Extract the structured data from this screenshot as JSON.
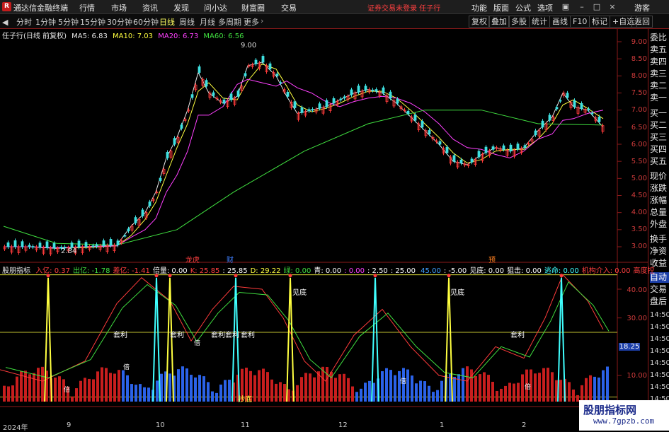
{
  "titlebar": {
    "logo": "R",
    "app_name": "通达信金融终端",
    "menus": [
      "行情",
      "市场",
      "资讯",
      "发现",
      "问小达",
      "财富圈",
      "交易"
    ],
    "notice": "证券交易未登录  任子行",
    "right_menus": [
      "功能",
      "版面",
      "公式",
      "选项"
    ],
    "guest": "游客"
  },
  "toolbar": {
    "periods": [
      "分时",
      "1分钟",
      "5分钟",
      "15分钟",
      "30分钟",
      "60分钟",
      "日线",
      "周线",
      "月线",
      "多周期",
      "更多"
    ],
    "active_period": "日线",
    "right_buttons": [
      "复权",
      "叠加",
      "多股",
      "统计",
      "画线",
      "F10",
      "标记",
      "+自选",
      "返回"
    ]
  },
  "stock": {
    "name": "任子行(日线 前复权)",
    "ma5": "MA5: 6.83",
    "ma10": "MA10: 7.03",
    "ma20": "MA20: 6.73",
    "ma60": "MA60: 6.56",
    "high_label": "9.00",
    "low_label": "2.84",
    "markers": [
      " 龙虎",
      "财",
      "预"
    ]
  },
  "price_axis": [
    "9.00",
    "8.50",
    "8.00",
    "7.50",
    "7.00",
    "6.50",
    "6.00",
    "5.50",
    "5.00",
    "4.50",
    "4.00",
    "3.50",
    "3.00"
  ],
  "right_panel": [
    "委比",
    "卖五",
    "卖四",
    "卖三",
    "卖二",
    "卖一",
    "买一",
    "买二",
    "买三",
    "买四",
    "买五",
    "现价",
    "涨跌",
    "涨幅",
    "总量",
    "外盘",
    "换手",
    "净资",
    "收益"
  ],
  "right_panel2": [
    "自动",
    "交易",
    "盘后"
  ],
  "time_ticks": [
    "14:50",
    "14:50",
    "14:50",
    "14:50",
    "14:50",
    "14:50",
    "14:50",
    "14:50"
  ],
  "indicator": {
    "name": "股朋指标",
    "items": [
      {
        "label": "入亿:",
        "value": "0.37",
        "color": "#ff4040"
      },
      {
        "label": "出亿:",
        "value": "-1.78",
        "color": "#40e040"
      },
      {
        "label": "差亿:",
        "value": "-1.41",
        "color": "#ff4040"
      },
      {
        "label": "倍量:",
        "value": "0.00",
        "color": "#ffffff"
      },
      {
        "label": "K:",
        "value": "25.85",
        "color": "#ff4040"
      },
      {
        "label": ":",
        "value": "25.85",
        "color": "#ffffff"
      },
      {
        "label": "D:",
        "value": "29.22",
        "color": "#ffff40"
      },
      {
        "label": "绿:",
        "value": "0.00",
        "color": "#40e040"
      },
      {
        "label": "青:",
        "value": "0.00",
        "color": "#ffffff"
      },
      {
        "label": ":",
        "value": "0.00",
        "color": "#ff40ff"
      },
      {
        "label": ":",
        "value": "2.50",
        "color": "#ffffff"
      },
      {
        "label": ":",
        "value": "25.00",
        "color": "#ffffff"
      },
      {
        "label": "",
        "value": "45.00",
        "color": "#40a0ff"
      },
      {
        "label": ":",
        "value": "-5.00",
        "color": "#ffffff"
      },
      {
        "label": "见底:",
        "value": "0.00",
        "color": "#ffffff"
      },
      {
        "label": "狙击:",
        "value": "0.00",
        "color": "#ffffff"
      },
      {
        "label": "逃命:",
        "value": "0.00",
        "color": "#40ffff"
      },
      {
        "label": "机构介入:",
        "value": "0.00",
        "color": "#ff4040"
      },
      {
        "label": "高度控",
        "value": "",
        "color": "#ff4040"
      }
    ],
    "axis": [
      "40.00",
      "30.00",
      "18.25",
      "10.00"
    ],
    "annotations": [
      "见底",
      "见底",
      "套利",
      "套利",
      "套利",
      "套利",
      "套利",
      "套利",
      "倍",
      "倍",
      "倍",
      "倍",
      "倍",
      "抄底"
    ]
  },
  "x_axis": [
    "2024年",
    "9",
    "10",
    "11",
    "12",
    "1",
    "2"
  ],
  "watermark": {
    "line1": "股朋指标网",
    "line2": "www.7gpzb.com"
  }
}
